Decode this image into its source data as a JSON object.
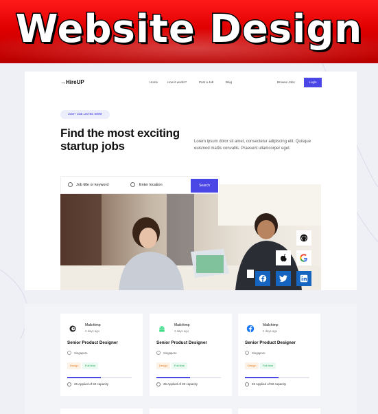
{
  "banner": {
    "title": "Website Design"
  },
  "nav": {
    "logo": "→HireUP",
    "links": [
      "Home",
      "How it works?",
      "Post a Job",
      "Blog"
    ],
    "browse_jobs": "Browse Jobs",
    "login": "Login"
  },
  "hero": {
    "badge": "1000+ JOB LISTED HERE",
    "title": "Find the most exciting startup jobs",
    "description": "Lorem ipsum dolor sit amet, consectetur adipiscing elit. Quisque euismod mattis convallis. Praesent ullamcorper eget."
  },
  "search": {
    "keyword_placeholder": "Job title or keyword",
    "location_placeholder": "Enter location",
    "button": "Search"
  },
  "social_icons": [
    "github-icon",
    "apple-icon",
    "google-icon",
    "facebook-icon",
    "twitter-icon",
    "linkedin-icon"
  ],
  "jobs": [
    {
      "company": "Mailchimp",
      "posted": "2 days ago",
      "title": "Senior Product Designer",
      "location": "Singapore",
      "tags": [
        "Design",
        "Full time"
      ],
      "capacity": "26 Applied of 50 capacity",
      "progress": 0.52,
      "logo_icon": "mailchimp-icon"
    },
    {
      "company": "Mailchimp",
      "posted": "2 days ago",
      "title": "Senior Product Designer",
      "location": "Singapore",
      "tags": [
        "Design",
        "Full time"
      ],
      "capacity": "26 Applied of 50 capacity",
      "progress": 0.52,
      "logo_icon": "android-icon"
    },
    {
      "company": "Mailchimp",
      "posted": "2 days ago",
      "title": "Senior Product Designer",
      "location": "Singapore",
      "tags": [
        "Design",
        "Full time"
      ],
      "capacity": "26 Applied of 50 capacity",
      "progress": 0.52,
      "logo_icon": "facebook-icon"
    }
  ],
  "colors": {
    "accent": "#4b47e6",
    "banner_red": "#e00000",
    "tag_design": "#e67e22",
    "tag_full": "#27ae60"
  }
}
